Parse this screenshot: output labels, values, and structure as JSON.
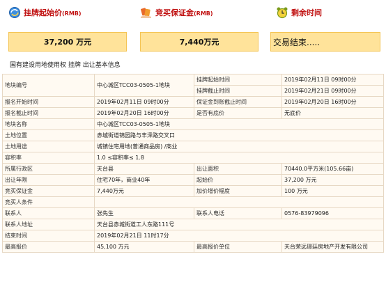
{
  "summary": {
    "start_price": {
      "label": "挂牌起始价",
      "label_suffix": "(RMB)",
      "value": "37,200  万元",
      "icon": "refresh-globe-icon"
    },
    "deposit": {
      "label": "竞买保证金",
      "label_suffix": "(RMB)",
      "value": "7,440万元",
      "icon": "money-hand-icon"
    },
    "remaining": {
      "label": "剩余时间",
      "value": "交易结束.....",
      "icon": "alarm-clock-icon"
    }
  },
  "section_title": "国有建设用地使用权 挂牌 出让基本信息",
  "table": {
    "row1": {
      "plot_no_label": "地块编号",
      "plot_no_value": "中心城区TCC03-0505-1地块",
      "list_start_label": "挂牌起始时间",
      "list_start_value": "2019年02月11日 09时00分",
      "list_end_label": "挂牌截止时间",
      "list_end_value": "2019年02月21日 09时00分"
    },
    "row2": {
      "k1": "报名开始时间",
      "v1": "2019年02月11日 09时00分",
      "k2": "保证金到账截止时间",
      "v2": "2019年02月20日 16时00分"
    },
    "row3": {
      "k1": "报名截止时间",
      "v1": "2019年02月20日 16时00分",
      "k2": "是否有底价",
      "v2": "无底价"
    },
    "row4": {
      "k": "地块名称",
      "v": "中心城区TCC03-0505-1地块"
    },
    "row5": {
      "k": "土地位置",
      "v": "赤城街道锦园路与丰泽路交叉口"
    },
    "row6": {
      "k": "土地用途",
      "v": "城镇住宅用地(普通商品房) /商业"
    },
    "row7": {
      "k": "容积率",
      "v": "1.0  ≤容积率≤ 1.8"
    },
    "row8": {
      "k1": "所属行政区",
      "v1": "天台县",
      "k2": "出让面积",
      "v2": "70440.0平方米(105.66亩)"
    },
    "row9": {
      "k1": "出让年限",
      "v1": "住宅70年，商业40年",
      "k2": "起始价",
      "v2": "37,200  万元"
    },
    "row10": {
      "k1": "竞买保证金",
      "v1": "7,440万元",
      "k2": "加价增价幅度",
      "v2": "100  万元"
    },
    "row11": {
      "k": "竞买人条件",
      "v": ""
    },
    "row12": {
      "k1": "联系人",
      "v1": "张先生",
      "k2": "联系人电话",
      "v2": "0576-83979096"
    },
    "row13": {
      "k": "联系人地址",
      "v": "天台县赤城街道工人东路111号"
    },
    "row14": {
      "k": "结束时间",
      "v": "2019年02月21日 11时17分"
    },
    "row15": {
      "k1": "最高报价",
      "v1": "45,100  万元",
      "k2": "最高报价单位",
      "v2": "天台荣远璟廷房地产开发有限公司"
    }
  },
  "colors": {
    "title_red": "#c01010",
    "value_bg": "#ffe39a",
    "value_border": "#f4c454",
    "table_bg": "#fffaf2",
    "border": "#e7d8c4"
  }
}
